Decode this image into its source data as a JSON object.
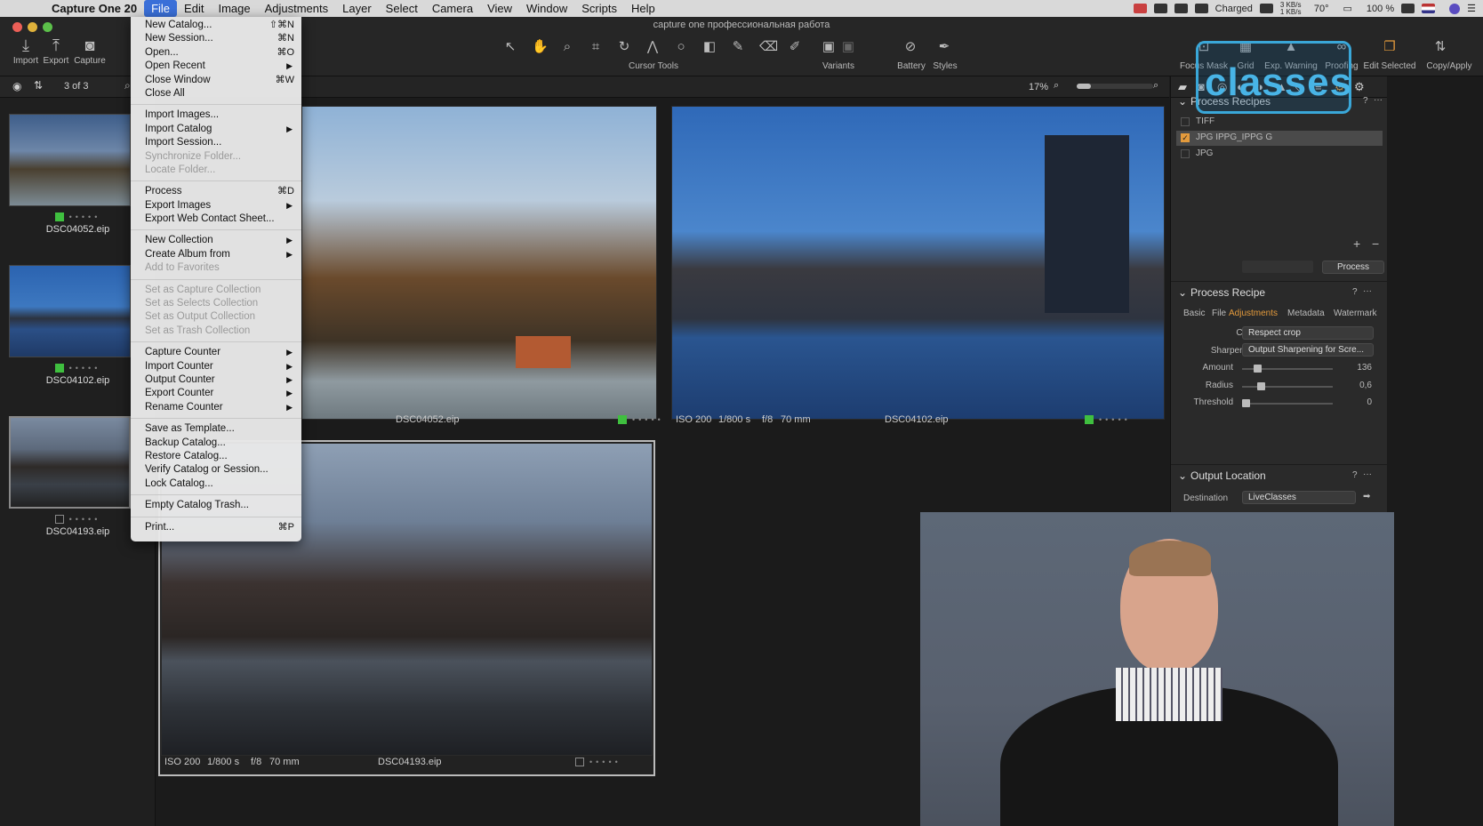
{
  "menubar": {
    "app_name": "Capture One 20",
    "items": [
      "File",
      "Edit",
      "Image",
      "Adjustments",
      "Layer",
      "Select",
      "Camera",
      "View",
      "Window",
      "Scripts",
      "Help"
    ],
    "status": {
      "battery_text": "Charged",
      "net_speed": "3 KB/s 1 KB/s",
      "temperature": "70°",
      "battery_percent": "100 %"
    }
  },
  "window": {
    "title": "capture one профессиональная работа"
  },
  "toolbar": {
    "left_buttons": [
      {
        "label": "Import",
        "icon": "import-icon"
      },
      {
        "label": "Export",
        "icon": "export-icon"
      },
      {
        "label": "Capture",
        "icon": "camera-icon"
      }
    ],
    "cursor_tools_label": "Cursor Tools",
    "variants_label": "Variants",
    "battery_label": "Battery",
    "styles_label": "Styles",
    "right_buttons": [
      "Focus Mask",
      "Grid",
      "Exp. Warning",
      "Proofing",
      "Edit Selected",
      "Copy/Apply"
    ]
  },
  "browser": {
    "count": "3 of 3",
    "items": [
      {
        "name": "DSC04052.eip",
        "tagged": true
      },
      {
        "name": "DSC04102.eip",
        "tagged": true
      },
      {
        "name": "DSC04193.eip",
        "tagged": false
      }
    ]
  },
  "viewer": {
    "zoom": "17%",
    "images": [
      {
        "name": "DSC04052.eip",
        "iso": "",
        "shutter": "",
        "aperture": "",
        "focal": ""
      },
      {
        "name": "DSC04102.eip",
        "iso": "ISO 200",
        "shutter": "1/800 s",
        "aperture": "f/8",
        "focal": "70 mm"
      },
      {
        "name": "DSC04193.eip",
        "iso": "ISO 200",
        "shutter": "1/800 s",
        "aperture": "f/8",
        "focal": "70 mm"
      }
    ]
  },
  "process_recipes": {
    "title": "Process Recipes",
    "recipes": [
      {
        "name": "TIFF",
        "checked": false
      },
      {
        "name": "JPG IPPG_IPPG G",
        "checked": true
      },
      {
        "name": "JPG",
        "checked": false
      }
    ],
    "process_button": "Process"
  },
  "process_recipe": {
    "title": "Process Recipe",
    "tabs": [
      "Basic",
      "File",
      "Adjustments",
      "Metadata",
      "Watermark"
    ],
    "active_tab": "Adjustments",
    "crop_label": "Crop",
    "crop_value": "Respect crop",
    "sharpening_label": "Sharpening",
    "sharpening_value": "Output Sharpening for Scre...",
    "sliders": [
      {
        "label": "Amount",
        "value": "136",
        "fraction": 0.14
      },
      {
        "label": "Radius",
        "value": "0,6",
        "fraction": 0.18
      },
      {
        "label": "Threshold",
        "value": "0",
        "fraction": 0.0
      }
    ]
  },
  "output_location": {
    "title": "Output Location",
    "destination_label": "Destination",
    "destination_value": "LiveClasses"
  },
  "file_menu": {
    "groups": [
      [
        {
          "label": "New Catalog...",
          "shortcut": "⇧⌘N"
        },
        {
          "label": "New Session...",
          "shortcut": "⌘N"
        },
        {
          "label": "Open...",
          "shortcut": "⌘O"
        },
        {
          "label": "Open Recent",
          "submenu": true
        },
        {
          "label": "Close Window",
          "shortcut": "⌘W"
        },
        {
          "label": "Close All"
        }
      ],
      [
        {
          "label": "Import Images..."
        },
        {
          "label": "Import Catalog",
          "submenu": true
        },
        {
          "label": "Import Session..."
        },
        {
          "label": "Synchronize Folder...",
          "disabled": true
        },
        {
          "label": "Locate Folder...",
          "disabled": true
        }
      ],
      [
        {
          "label": "Process",
          "shortcut": "⌘D"
        },
        {
          "label": "Export Images",
          "submenu": true
        },
        {
          "label": "Export Web Contact Sheet..."
        }
      ],
      [
        {
          "label": "New Collection",
          "submenu": true
        },
        {
          "label": "Create Album from",
          "submenu": true
        },
        {
          "label": "Add to Favorites",
          "disabled": true
        }
      ],
      [
        {
          "label": "Set as Capture Collection",
          "disabled": true
        },
        {
          "label": "Set as Selects Collection",
          "disabled": true
        },
        {
          "label": "Set as Output Collection",
          "disabled": true
        },
        {
          "label": "Set as Trash Collection",
          "disabled": true
        }
      ],
      [
        {
          "label": "Capture Counter",
          "submenu": true
        },
        {
          "label": "Import Counter",
          "submenu": true
        },
        {
          "label": "Output Counter",
          "submenu": true
        },
        {
          "label": "Export Counter",
          "submenu": true
        },
        {
          "label": "Rename Counter",
          "submenu": true
        }
      ],
      [
        {
          "label": "Save as Template..."
        },
        {
          "label": "Backup Catalog..."
        },
        {
          "label": "Restore Catalog..."
        },
        {
          "label": "Verify Catalog or Session..."
        },
        {
          "label": "Lock Catalog..."
        }
      ],
      [
        {
          "label": "Empty Catalog Trash..."
        }
      ],
      [
        {
          "label": "Print...",
          "shortcut": "⌘P"
        }
      ]
    ]
  },
  "watermark": {
    "logo_text": "classes"
  },
  "colors": {
    "accent": "#3a6fd8",
    "tag_green": "#3fbf3f",
    "orange": "#e39a3c",
    "logo_blue": "#48b4e6"
  }
}
